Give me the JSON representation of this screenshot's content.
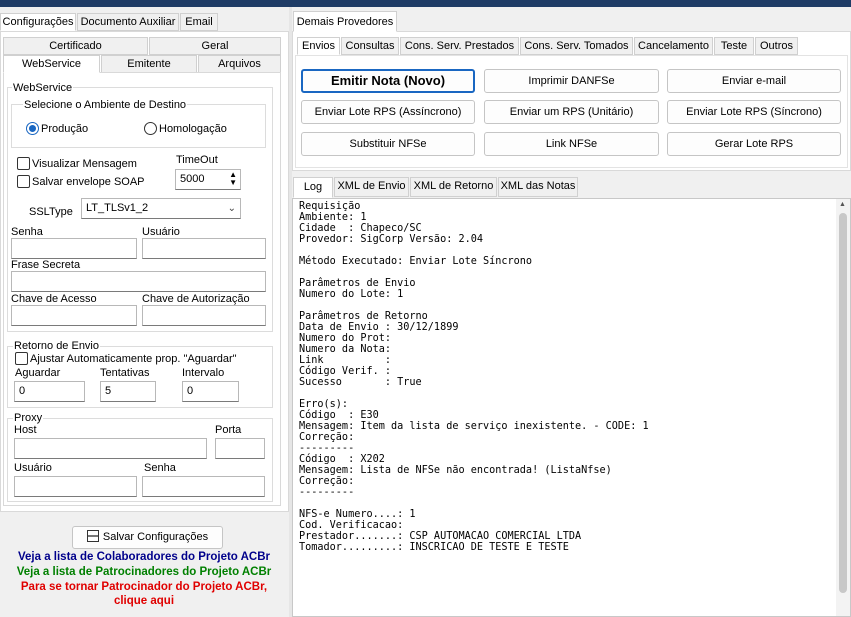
{
  "left_tabs": [
    "Configurações",
    "Documento Auxiliar",
    "Email"
  ],
  "config_tabs_row1": [
    "Certificado",
    "Geral"
  ],
  "config_tabs_row2": [
    "WebService",
    "Emitente",
    "Arquivos"
  ],
  "webservice": {
    "group_label": "WebService",
    "ambiente_label": "Selecione o Ambiente de Destino",
    "producao": "Produção",
    "homologacao": "Homologação",
    "visualizar": "Visualizar Mensagem",
    "salvar_envelope": "Salvar envelope SOAP",
    "timeout_label": "TimeOut",
    "timeout_value": "5000",
    "ssltype_label": "SSLType",
    "ssltype_value": "LT_TLSv1_2",
    "senha": "Senha",
    "usuario": "Usuário",
    "frase": "Frase Secreta",
    "chave_acesso": "Chave de Acesso",
    "chave_autorizacao": "Chave de Autorização"
  },
  "retorno": {
    "label": "Retorno de Envio",
    "ajustar": "Ajustar Automaticamente prop. \"Aguardar\"",
    "aguardar": "Aguardar",
    "tentativas": "Tentativas",
    "intervalo": "Intervalo",
    "aguardar_value": "0",
    "tentativas_value": "5",
    "intervalo_value": "0"
  },
  "proxy": {
    "label": "Proxy",
    "host": "Host",
    "porta": "Porta",
    "usuario": "Usuário",
    "senha": "Senha"
  },
  "salvar_button": "Salvar Configurações",
  "links": {
    "colaboradores": "Veja a lista de Colaboradores do Projeto ACBr",
    "patrocinadores": "Veja a lista de Patrocinadores do Projeto ACBr",
    "tornar1": "Para se tornar Patrocinador do Projeto ACBr,",
    "tornar2": "clique aqui",
    "colors": {
      "blue": "#00008b",
      "green": "#008000",
      "red": "#e00000"
    }
  },
  "right_top_tab": "Demais Provedores",
  "right_tabs": [
    "Envios",
    "Consultas",
    "Cons. Serv. Prestados",
    "Cons. Serv. Tomados",
    "Cancelamento",
    "Teste",
    "Outros"
  ],
  "actions": {
    "emitir": "Emitir Nota (Novo)",
    "imprimir": "Imprimir DANFSe",
    "email": "Enviar e-mail",
    "lote_assincrono": "Enviar Lote RPS (Assíncrono)",
    "rps_unitario": "Enviar um RPS (Unitário)",
    "lote_sincrono": "Enviar Lote RPS (Síncrono)",
    "substituir": "Substituir NFSe",
    "link": "Link NFSe",
    "gerar": "Gerar Lote RPS"
  },
  "log_tabs": [
    "Log",
    "XML de Envio",
    "XML de Retorno",
    "XML das Notas"
  ],
  "log_text": "Requisição\nAmbiente: 1\nCidade  : Chapeco/SC\nProvedor: SigCorp Versão: 2.04\n\nMétodo Executado: Enviar Lote Síncrono\n\nParâmetros de Envio\nNumero do Lote: 1\n\nParâmetros de Retorno\nData de Envio : 30/12/1899\nNumero do Prot:\nNumero da Nota:\nLink          :\nCódigo Verif. :\nSucesso       : True\n\nErro(s):\nCódigo  : E30\nMensagem: Item da lista de serviço inexistente. - CODE: 1\nCorreção:\n---------\nCódigo  : X202\nMensagem: Lista de NFSe não encontrada! (ListaNfse)\nCorreção:\n---------\n\nNFS-e Numero....: 1\nCod. Verificacao:\nPrestador.......: CSP AUTOMACAO COMERCIAL LTDA\nTomador.........: INSCRICAO DE TESTE E TESTE"
}
